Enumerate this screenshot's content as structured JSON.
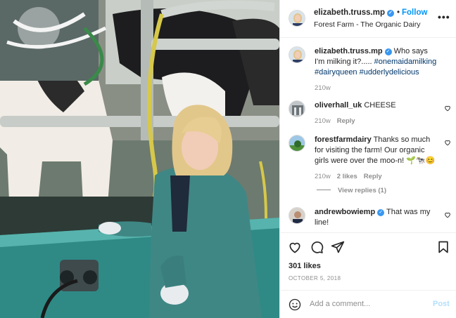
{
  "post": {
    "username": "elizabeth.truss.mp",
    "follow_label": "Follow",
    "location": "Forest Farm - The Organic Dairy",
    "more_icon": "more-options-icon",
    "likes": "301 likes",
    "date": "OCTOBER 5, 2018"
  },
  "caption": {
    "username": "elizabeth.truss.mp",
    "text": "Who says I'm milking it?.....",
    "hashtags": [
      "#onemaidamilking",
      "#dairyqueen",
      "#udderlydelicious"
    ],
    "time": "210w"
  },
  "comments": [
    {
      "username": "oliverhall_uk",
      "text": "CHEESE",
      "time": "210w",
      "likes": "",
      "reply": "Reply"
    },
    {
      "username": "forestfarmdairy",
      "text": "Thanks so much for visiting the farm! Our organic girls were over the moo-n! 🌱🐄😊",
      "time": "210w",
      "likes": "2 likes",
      "reply": "Reply"
    },
    {
      "username": "andrewbowiemp",
      "text": "That was my line!",
      "time": "",
      "likes": "",
      "reply": ""
    }
  ],
  "view_replies": "View replies (1)",
  "add_comment": {
    "placeholder": "Add a comment...",
    "post_label": "Post"
  },
  "colors": {
    "link": "#00376b",
    "follow": "#0095f6",
    "verified": "#3897f0",
    "muted": "#8e8e8e"
  }
}
